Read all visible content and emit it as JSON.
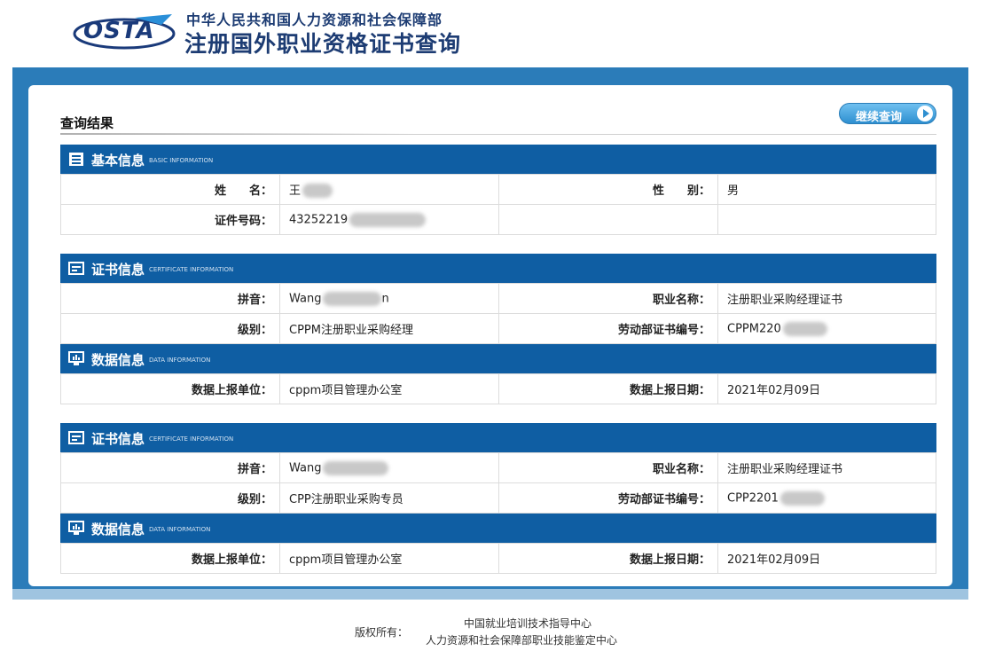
{
  "header": {
    "logo_text": "OSTA",
    "org_name": "中华人民共和国人力资源和社会保障部",
    "site_title": "注册国外职业资格证书查询"
  },
  "result": {
    "title": "查询结果",
    "continue_label": "继续查询"
  },
  "basic": {
    "title": "基本信息",
    "subtitle": "BASIC INFORMATION",
    "name_label": "姓　　名：",
    "name_value": "王",
    "gender_label": "性　　别：",
    "gender_value": "男",
    "id_label": "证件号码：",
    "id_value": "43252219"
  },
  "certificates": [
    {
      "cert_title": "证书信息",
      "cert_subtitle": "CERTIFICATE INFORMATION",
      "pinyin_label": "拼音：",
      "pinyin_value": "Wang",
      "pinyin_tail": "n",
      "job_label": "职业名称：",
      "job_value": "注册职业采购经理证书",
      "level_label": "级别：",
      "level_value": "CPPM注册职业采购经理",
      "certno_label": "劳动部证书编号：",
      "certno_value": "CPPM220",
      "data_title": "数据信息",
      "data_subtitle": "DATA INFORMATION",
      "unit_label": "数据上报单位：",
      "unit_value": "cppm项目管理办公室",
      "date_label": "数据上报日期：",
      "date_value": "2021年02月09日"
    },
    {
      "cert_title": "证书信息",
      "cert_subtitle": "CERTIFICATE INFORMATION",
      "pinyin_label": "拼音：",
      "pinyin_value": "Wang",
      "pinyin_tail": "",
      "job_label": "职业名称：",
      "job_value": "注册职业采购经理证书",
      "level_label": "级别：",
      "level_value": "CPP注册职业采购专员",
      "certno_label": "劳动部证书编号：",
      "certno_value": "CPP2201",
      "data_title": "数据信息",
      "data_subtitle": "DATA INFORMATION",
      "unit_label": "数据上报单位：",
      "unit_value": "cppm项目管理办公室",
      "date_label": "数据上报日期：",
      "date_value": "2021年02月09日"
    }
  ],
  "footer": {
    "label": "版权所有：",
    "line1": "中国就业培训技术指导中心",
    "line2": "人力资源和社会保障部职业技能鉴定中心"
  },
  "colors": {
    "brand_blue": "#0f5ea3",
    "frame_blue": "#2b7cb9",
    "button_blue": "#2e8fd0"
  }
}
